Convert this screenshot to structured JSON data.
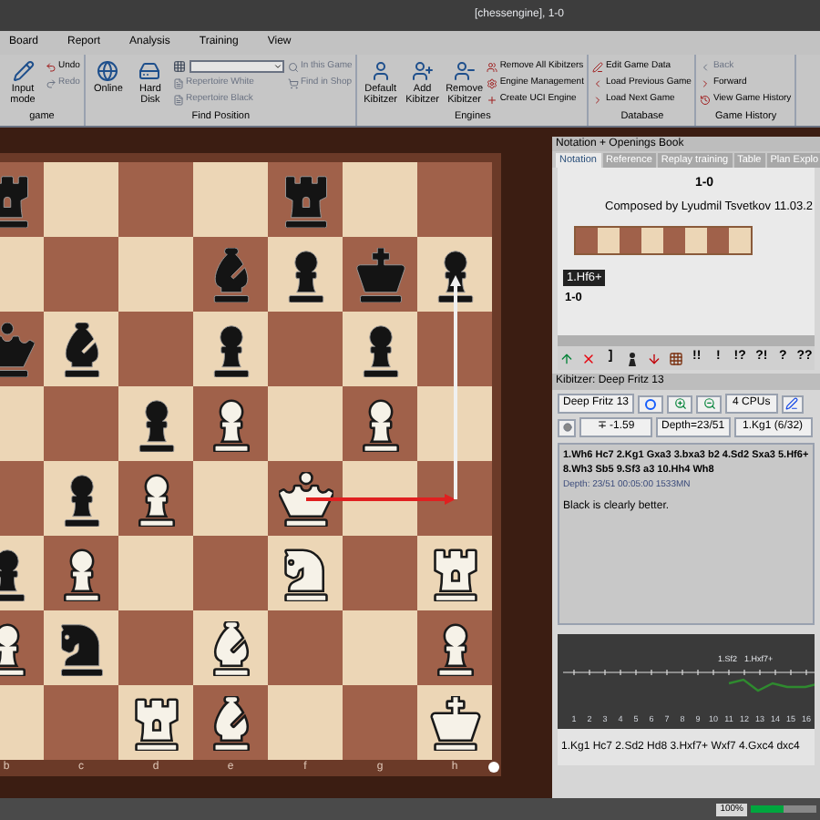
{
  "window": {
    "title": "[chessengine], 1-0"
  },
  "menu": [
    {
      "label": "Board",
      "selected": false
    },
    {
      "label": "Report",
      "selected": false
    },
    {
      "label": "Analysis",
      "selected": false
    },
    {
      "label": "Training",
      "selected": false
    },
    {
      "label": "View",
      "selected": false
    }
  ],
  "ribbon": [
    {
      "label": "game",
      "buttons": [
        {
          "kind": "big",
          "label": "Input mode",
          "disabled": false
        },
        {
          "kind": "small",
          "label": "Undo",
          "disabled": false
        },
        {
          "kind": "small",
          "label": "Redo",
          "disabled": true
        }
      ]
    },
    {
      "label": "Find Position",
      "buttons": [
        {
          "kind": "big",
          "label": "Online",
          "disabled": false
        },
        {
          "kind": "big",
          "label": "Hard Disk",
          "disabled": false
        },
        {
          "kind": "dropdown",
          "disabled": false
        },
        {
          "kind": "small",
          "label": "Repertoire White",
          "disabled": true
        },
        {
          "kind": "small",
          "label": "Repertoire Black",
          "disabled": true
        },
        {
          "kind": "small",
          "label": "In this Game",
          "disabled": true
        },
        {
          "kind": "small",
          "label": "Find in Shop",
          "disabled": true
        }
      ]
    },
    {
      "label": "Engines",
      "buttons": [
        {
          "kind": "big",
          "label": "Default Kibitzer",
          "disabled": false
        },
        {
          "kind": "big",
          "label": "Add Kibitzer",
          "disabled": false
        },
        {
          "kind": "big",
          "label": "Remove Kibitzer",
          "disabled": false
        },
        {
          "kind": "small",
          "label": "Remove All Kibitzers",
          "disabled": false
        },
        {
          "kind": "small",
          "label": "Engine Management",
          "disabled": false
        },
        {
          "kind": "small",
          "label": "Create UCI Engine",
          "disabled": false
        }
      ]
    },
    {
      "label": "Database",
      "buttons": [
        {
          "kind": "small",
          "label": "Edit Game Data",
          "disabled": false
        },
        {
          "kind": "small",
          "label": "Load Previous Game",
          "disabled": false
        },
        {
          "kind": "small",
          "label": "Load Next Game",
          "disabled": false
        }
      ]
    },
    {
      "label": "Game History",
      "buttons": [
        {
          "kind": "small",
          "label": "Back",
          "disabled": true
        },
        {
          "kind": "small",
          "label": "Forward",
          "disabled": false
        },
        {
          "kind": "small",
          "label": "View Game History",
          "disabled": false
        }
      ]
    }
  ],
  "board": {
    "files": [
      "b",
      "c",
      "d",
      "e",
      "f",
      "g",
      "h"
    ],
    "ranks": [
      {
        "squares": [
          {
            "kind": "blackrook"
          },
          {
            "kind": "empty"
          },
          {
            "kind": "empty"
          },
          {
            "kind": "empty"
          },
          {
            "kind": "blackrook"
          },
          {
            "kind": "empty"
          },
          {
            "kind": "empty"
          }
        ]
      },
      {
        "squares": [
          {
            "kind": "empty"
          },
          {
            "kind": "empty"
          },
          {
            "kind": "empty"
          },
          {
            "kind": "blackbishop"
          },
          {
            "kind": "blackpawn"
          },
          {
            "kind": "blackking"
          },
          {
            "kind": "blackpawn",
            "arrow_end": {
              "color": "#f0f0f0"
            }
          }
        ]
      },
      {
        "squares": [
          {
            "kind": "blackqueen"
          },
          {
            "kind": "blackbishop"
          },
          {
            "kind": "empty"
          },
          {
            "kind": "blackpawn"
          },
          {
            "kind": "empty"
          },
          {
            "kind": "blackpawn"
          },
          {
            "kind": "empty"
          }
        ]
      },
      {
        "squares": [
          {
            "kind": "empty"
          },
          {
            "kind": "empty"
          },
          {
            "kind": "blackpawn"
          },
          {
            "kind": "whitepawn"
          },
          {
            "kind": "empty"
          },
          {
            "kind": "whitepawn"
          },
          {
            "kind": "empty"
          }
        ]
      },
      {
        "squares": [
          {
            "kind": "empty"
          },
          {
            "kind": "blackpawn"
          },
          {
            "kind": "whitepawn"
          },
          {
            "kind": "empty"
          },
          {
            "kind": "whitequeen",
            "arrow_start": {
              "color": "#e02020"
            }
          },
          {
            "kind": "empty"
          },
          {
            "kind": "empty",
            "arrow_end": {
              "color": "#e02020"
            },
            "arrow_start": {
              "color": "#f0f0f0"
            }
          }
        ]
      },
      {
        "squares": [
          {
            "kind": "blackpawn"
          },
          {
            "kind": "whitepawn"
          },
          {
            "kind": "empty"
          },
          {
            "kind": "empty"
          },
          {
            "kind": "whiteknight"
          },
          {
            "kind": "empty"
          },
          {
            "kind": "whiterook"
          }
        ]
      },
      {
        "squares": [
          {
            "kind": "whitepawn"
          },
          {
            "kind": "blackknight"
          },
          {
            "kind": "empty"
          },
          {
            "kind": "whitebishop"
          },
          {
            "kind": "empty"
          },
          {
            "kind": "empty"
          },
          {
            "kind": "whitepawn"
          }
        ]
      },
      {
        "squares": [
          {
            "kind": "empty"
          },
          {
            "kind": "empty"
          },
          {
            "kind": "whiterook"
          },
          {
            "kind": "whitebishop"
          },
          {
            "kind": "empty"
          },
          {
            "kind": "empty"
          },
          {
            "kind": "whiteking"
          }
        ]
      }
    ],
    "white_to_move": true
  },
  "notation": {
    "title": "Notation + Openings Book",
    "tabs": [
      {
        "label": "Notation",
        "selected": true
      },
      {
        "label": "Reference",
        "selected": false
      },
      {
        "label": "Replay training",
        "selected": false
      },
      {
        "label": "Table",
        "selected": false
      },
      {
        "label": "Plan Explo",
        "selected": false
      }
    ],
    "result": "1-0",
    "source": "Composed by Lyudmil Tsvetkov 11.03.2",
    "moves": [
      {
        "text": "1.Hf6+",
        "selected": true
      }
    ],
    "final_result": "1-0"
  },
  "annotation_buttons": [
    {
      "kind": "up"
    },
    {
      "kind": "cross"
    },
    {
      "kind": "text",
      "label": "]"
    },
    {
      "kind": "pawn"
    },
    {
      "kind": "down"
    },
    {
      "kind": "grid"
    },
    {
      "kind": "text",
      "label": "!!"
    },
    {
      "kind": "text",
      "label": "!"
    },
    {
      "kind": "text",
      "label": "!?"
    },
    {
      "kind": "text",
      "label": "?!"
    },
    {
      "kind": "text",
      "label": "?"
    },
    {
      "kind": "text",
      "label": "??"
    }
  ],
  "kibitzer": {
    "title": "Kibitzer: Deep Fritz 13",
    "engine": "Deep Fritz 13",
    "cpus": "4 CPUs",
    "evaluation": "∓ -1.59",
    "depth": "Depth=23/51",
    "best_move": "1.Kg1 (6/32)",
    "lines": [
      "1.Wh6 Hc7 2.Kg1 Gxa3 3.bxa3 b2 4.Sd2 Sxa3 5.Hf6+",
      "8.Wh3 Sb5 9.Sf3 a3 10.Hh4 Wh8"
    ],
    "info": "Depth: 23/51 00:05:00 1533MN",
    "assessment": "Black is clearly better.",
    "graph": {
      "move_labels": [
        "1.Sf2",
        "1.Hxf7+"
      ],
      "x_labels": [
        "1",
        "2",
        "3",
        "4",
        "5",
        "6",
        "7",
        "8",
        "9",
        "10",
        "11",
        "12",
        "13",
        "14",
        "15",
        "16"
      ]
    },
    "bottom_line": "1.Kg1 Hc7 2.Sd2 Hd8 3.Hxf7+ Wxf7 4.Gxc4 dxc4"
  },
  "status_bar": {
    "zoom": "100%",
    "level": 0.5
  }
}
